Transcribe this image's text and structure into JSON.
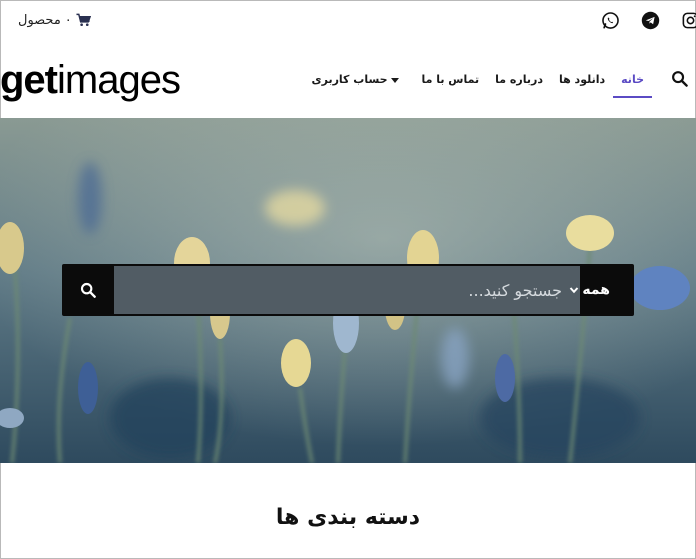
{
  "topbar": {
    "social": [
      "instagram-icon",
      "telegram-icon",
      "whatsapp-icon"
    ],
    "cart": {
      "count": "۰",
      "label": "محصول",
      "icon": "shopping-cart-icon"
    }
  },
  "header": {
    "logo": {
      "bold": "get",
      "thin": "images"
    },
    "nav": [
      {
        "label": "خانه",
        "active": true
      },
      {
        "label": "دانلود ها"
      },
      {
        "label": "درباره ما"
      },
      {
        "label": "تماس با ما"
      },
      {
        "label": "حساب کاربری",
        "dropdown": true
      }
    ],
    "search_icon": "search-icon"
  },
  "hero": {
    "search": {
      "placeholder": "جستجو کنید...",
      "category": "همه"
    }
  },
  "section": {
    "title": "دسته بندی ها"
  },
  "colors": {
    "accent": "#5b4bc4",
    "search_bar": "#0b0b0b"
  }
}
